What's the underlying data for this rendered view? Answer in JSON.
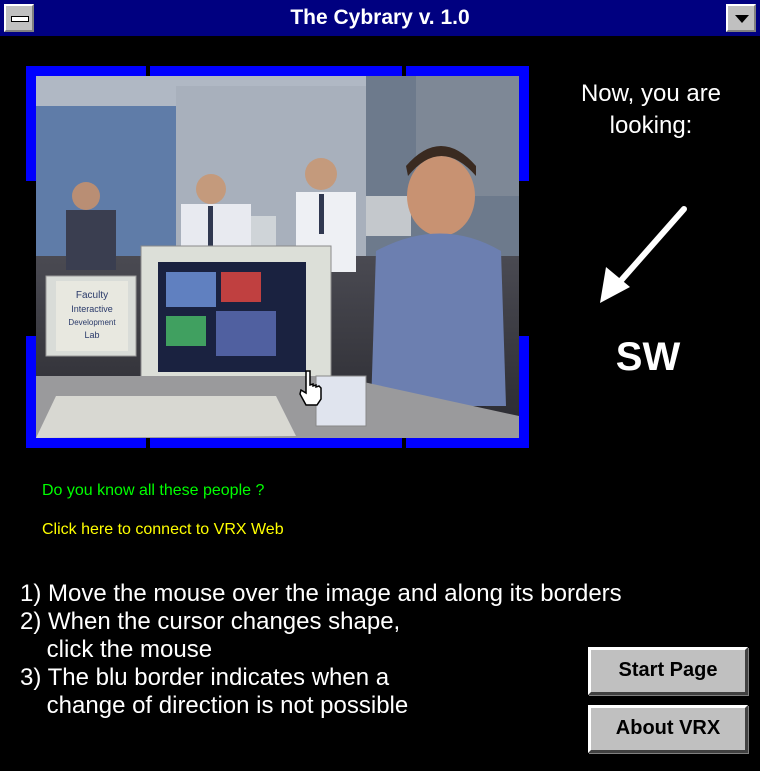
{
  "window": {
    "title": "The Cybrary v. 1.0"
  },
  "panorama": {
    "sign_text": [
      "Faculty",
      "Interactive",
      "Development",
      "Lab"
    ]
  },
  "direction": {
    "label_line1": "Now, you are",
    "label_line2": "looking:",
    "value": "SW",
    "arrow_icon": "arrow-down-left"
  },
  "links": {
    "people": "Do you know all these people ?",
    "connect": "Click here to connect to VRX Web"
  },
  "instructions": [
    "1) Move the mouse over the image and along its borders",
    "2) When the cursor changes shape,",
    "    click the mouse",
    "3) The blu border indicates when a",
    "    change of direction is not possible"
  ],
  "buttons": {
    "start_page": "Start Page",
    "about_vrx": "About VRX"
  },
  "colors": {
    "titlebar": "#000080",
    "border": "#0000ff",
    "link_green": "#00ff00",
    "link_yellow": "#ffff00"
  }
}
